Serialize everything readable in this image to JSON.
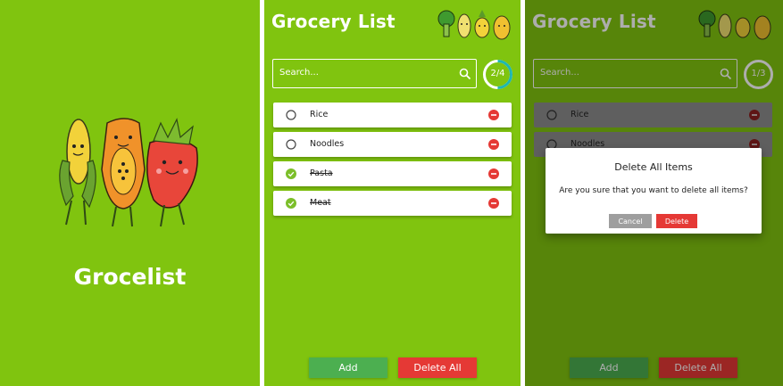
{
  "colors": {
    "background": "#80c40f",
    "add_button": "#4caf50",
    "delete_button": "#e53935",
    "progress_ring": "#1fb7b0",
    "check": "#7cbf2a"
  },
  "splash": {
    "app_name": "Grocelist"
  },
  "list_screen": {
    "title": "Grocery List",
    "search_placeholder": "Search...",
    "progress_text": "2/4",
    "progress_fraction": 0.5,
    "items": [
      {
        "label": "Rice",
        "checked": false
      },
      {
        "label": "Noodles",
        "checked": false
      },
      {
        "label": "Pasta",
        "checked": true
      },
      {
        "label": "Meat",
        "checked": true
      }
    ],
    "add_label": "Add",
    "delete_all_label": "Delete All",
    "icons": [
      "search-icon",
      "remove-icon",
      "radio-unchecked-icon",
      "check-circle-icon"
    ]
  },
  "dialog_screen": {
    "title": "Grocery List",
    "search_placeholder": "Search...",
    "progress_text": "1/3",
    "items": [
      {
        "label": "Rice"
      },
      {
        "label": "Noodles"
      }
    ],
    "add_label": "Add",
    "delete_all_label": "Delete All",
    "dialog": {
      "title": "Delete All Items",
      "message": "Are you sure that you want to delete all items?",
      "cancel_label": "Cancel",
      "delete_label": "Delete"
    }
  }
}
